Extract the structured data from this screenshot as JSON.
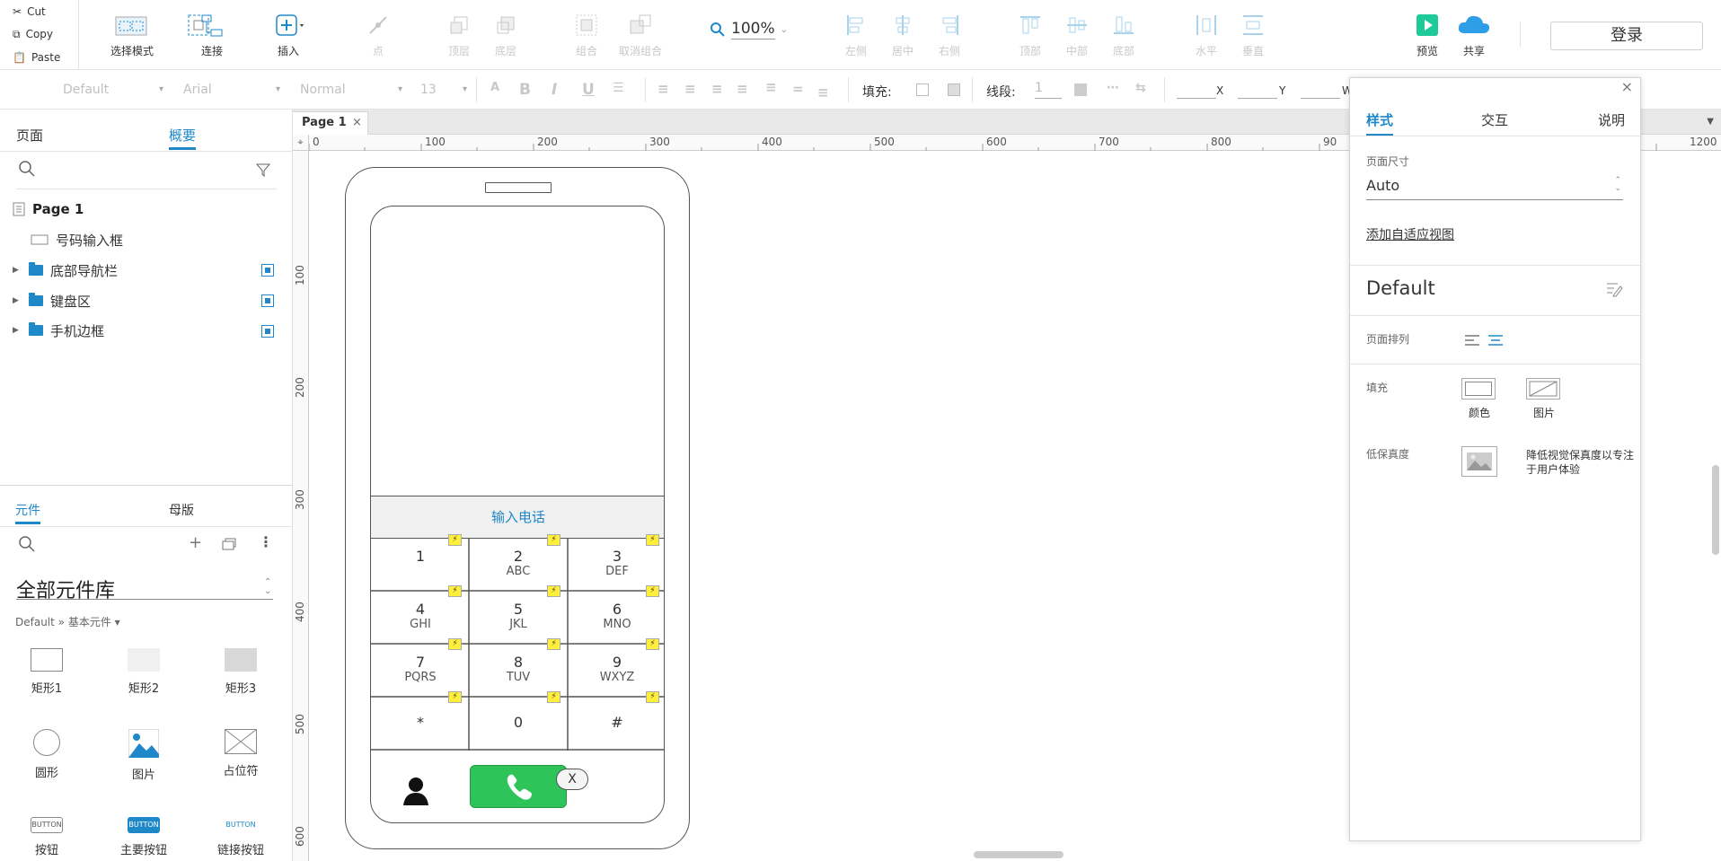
{
  "clipboard": {
    "cut": "Cut",
    "copy": "Copy",
    "paste": "Paste"
  },
  "toolbar": {
    "select_mode": "选择模式",
    "connect": "连接",
    "insert": "插入",
    "point": "点",
    "top_layer": "顶层",
    "bottom_layer": "底层",
    "group": "组合",
    "ungroup": "取消组合",
    "zoom": "100%",
    "align_left": "左侧",
    "align_center": "居中",
    "align_right": "右侧",
    "align_top": "顶部",
    "align_middle": "中部",
    "align_bottom": "底部",
    "distribute_h": "水平",
    "distribute_v": "垂直",
    "preview": "预览",
    "share": "共享",
    "login": "登录"
  },
  "formatbar": {
    "style": "Default",
    "font": "Arial",
    "weight": "Normal",
    "size": "13",
    "fill_label": "填充:",
    "line_label": "线段:",
    "line_value": "1",
    "x_label": "X",
    "y_label": "Y",
    "w_label": "W"
  },
  "leftpanel": {
    "tabs": [
      "页面",
      "概要"
    ],
    "outline": {
      "page": "Page 1",
      "items": [
        "号码输入框",
        "底部导航栏",
        "键盘区",
        "手机边框"
      ]
    },
    "lib_tabs": [
      "元件",
      "母版"
    ],
    "library_name": "全部元件库",
    "breadcrumb": "Default » 基本元件 ▾",
    "widgets": [
      "矩形1",
      "矩形2",
      "矩形3",
      "圆形",
      "图片",
      "占位符",
      "按钮",
      "主要按钮",
      "链接按钮"
    ],
    "button_texts": [
      "BUTTON",
      "BUTTON",
      "BUTTON"
    ]
  },
  "canvas": {
    "page_tab": "Page 1",
    "ruler_h": [
      "0",
      "100",
      "200",
      "300",
      "400",
      "500",
      "600",
      "700",
      "800",
      "90",
      "1200"
    ],
    "ruler_v": [
      "100",
      "200",
      "300",
      "400",
      "500",
      "600"
    ],
    "phone": {
      "input_label": "输入电话",
      "keys": [
        {
          "n": "1",
          "s": ""
        },
        {
          "n": "2",
          "s": "ABC"
        },
        {
          "n": "3",
          "s": "DEF"
        },
        {
          "n": "4",
          "s": "GHI"
        },
        {
          "n": "5",
          "s": "JKL"
        },
        {
          "n": "6",
          "s": "MNO"
        },
        {
          "n": "7",
          "s": "PQRS"
        },
        {
          "n": "8",
          "s": "TUV"
        },
        {
          "n": "9",
          "s": "WXYZ"
        },
        {
          "n": "*",
          "s": ""
        },
        {
          "n": "0",
          "s": ""
        },
        {
          "n": "#",
          "s": ""
        }
      ],
      "close_key": "X",
      "call_color": "#2ec45a"
    }
  },
  "inspector": {
    "tabs": [
      "样式",
      "交互",
      "说明"
    ],
    "page_size_label": "页面尺寸",
    "page_size_value": "Auto",
    "add_adaptive": "添加自适应视图",
    "style_name": "Default",
    "page_align_label": "页面排列",
    "fill_label": "填充",
    "fill_color": "颜色",
    "fill_image": "图片",
    "low_fidelity_label": "低保真度",
    "low_fidelity_desc": "降低视觉保真度以专注于用户体验"
  },
  "colors": {
    "accent": "#1e88c8",
    "preview_green": "#1ec99a",
    "share_blue": "#2f9ee8"
  }
}
